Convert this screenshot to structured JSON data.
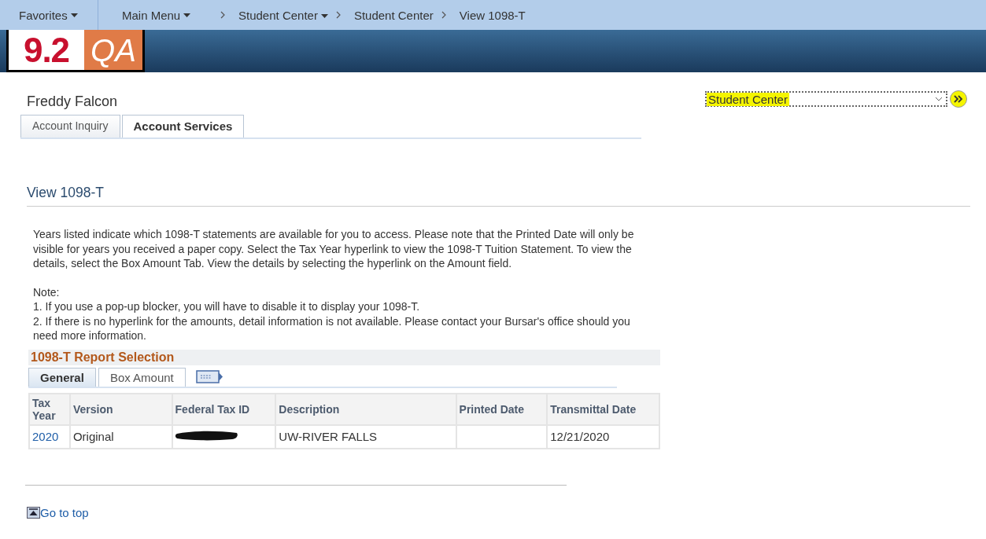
{
  "nav": {
    "items": [
      {
        "label": "Favorites",
        "dropdown": true
      },
      {
        "label": "Main Menu",
        "dropdown": true
      }
    ],
    "breadcrumbs": [
      {
        "label": "Student Center",
        "dropdown": true
      },
      {
        "label": "Student Center",
        "dropdown": false
      },
      {
        "label": "View 1098-T",
        "dropdown": false
      }
    ]
  },
  "banner": {
    "logo_number": "9.2",
    "logo_env": "QA"
  },
  "user_name": "Freddy Falcon",
  "nav_select": {
    "value": "Student Center",
    "highlighted": true
  },
  "tabs": [
    {
      "label": "Account Inquiry",
      "selected": false
    },
    {
      "label": "Account Services",
      "selected": true
    }
  ],
  "page_title": "View 1098-T",
  "intro": "Years listed indicate which 1098-T statements are available for you to access.  Please note that the Printed Date will only be visible for years you received a paper copy.  Select the Tax Year hyperlink to view the 1098-T Tuition Statement.  To view the details, select the Box Amount Tab.  View the details by selecting the hyperlink on the Amount field.",
  "note_title": "Note:",
  "notes": [
    "1.  If you use a pop-up blocker, you will have to disable it to display your 1098-T.",
    "2.  If there is no hyperlink for the amounts, detail information is not available.  Please contact your Bursar's office should you need more information."
  ],
  "report": {
    "title": "1098-T Report Selection",
    "tabs": [
      {
        "label": "General",
        "selected": true
      },
      {
        "label": "Box Amount",
        "selected": false
      }
    ],
    "columns": [
      "Tax Year",
      "Version",
      "Federal Tax ID",
      "Description",
      "Printed Date",
      "Transmittal Date"
    ],
    "rows": [
      {
        "tax_year": "2020",
        "version": "Original",
        "federal_tax_id_redacted": true,
        "description": "UW-RIVER FALLS",
        "printed_date": "",
        "transmittal_date": "12/21/2020"
      }
    ]
  },
  "go_to_top": "Go to top"
}
